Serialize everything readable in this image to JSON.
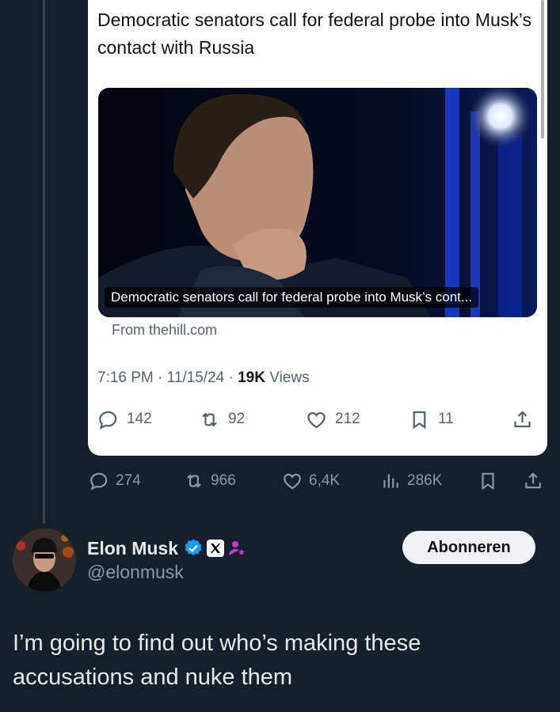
{
  "quoted_tweet": {
    "headline": "Democratic senators call for federal probe into Musk’s contact with Russia",
    "media_caption": "Democratic senators call for federal probe into Musk’s cont...",
    "source": "From thehill.com",
    "time": "7:16 PM",
    "date": "11/15/24",
    "views_count": "19K",
    "views_label": "Views",
    "actions": {
      "replies": "142",
      "reposts": "92",
      "likes": "212",
      "bookmarks": "11"
    }
  },
  "outer_actions": {
    "replies": "274",
    "reposts": "966",
    "likes": "6,4K",
    "views": "286K"
  },
  "author": {
    "name": "Elon Musk",
    "handle": "@elonmusk",
    "subscribe_label": "Abonneren"
  },
  "tweet_text": "I’m going to find out who’s making these accusations and nuke them",
  "colors": {
    "background": "#15202b",
    "card": "#ffffff",
    "verified": "#1d9bf0",
    "affiliate": "#c936cc",
    "muted": "#8b98a5"
  },
  "icons": [
    "reply-icon",
    "repost-icon",
    "like-icon",
    "bookmark-icon",
    "share-icon",
    "views-icon",
    "verified-badge-icon",
    "x-logo-icon",
    "affiliate-icon"
  ]
}
